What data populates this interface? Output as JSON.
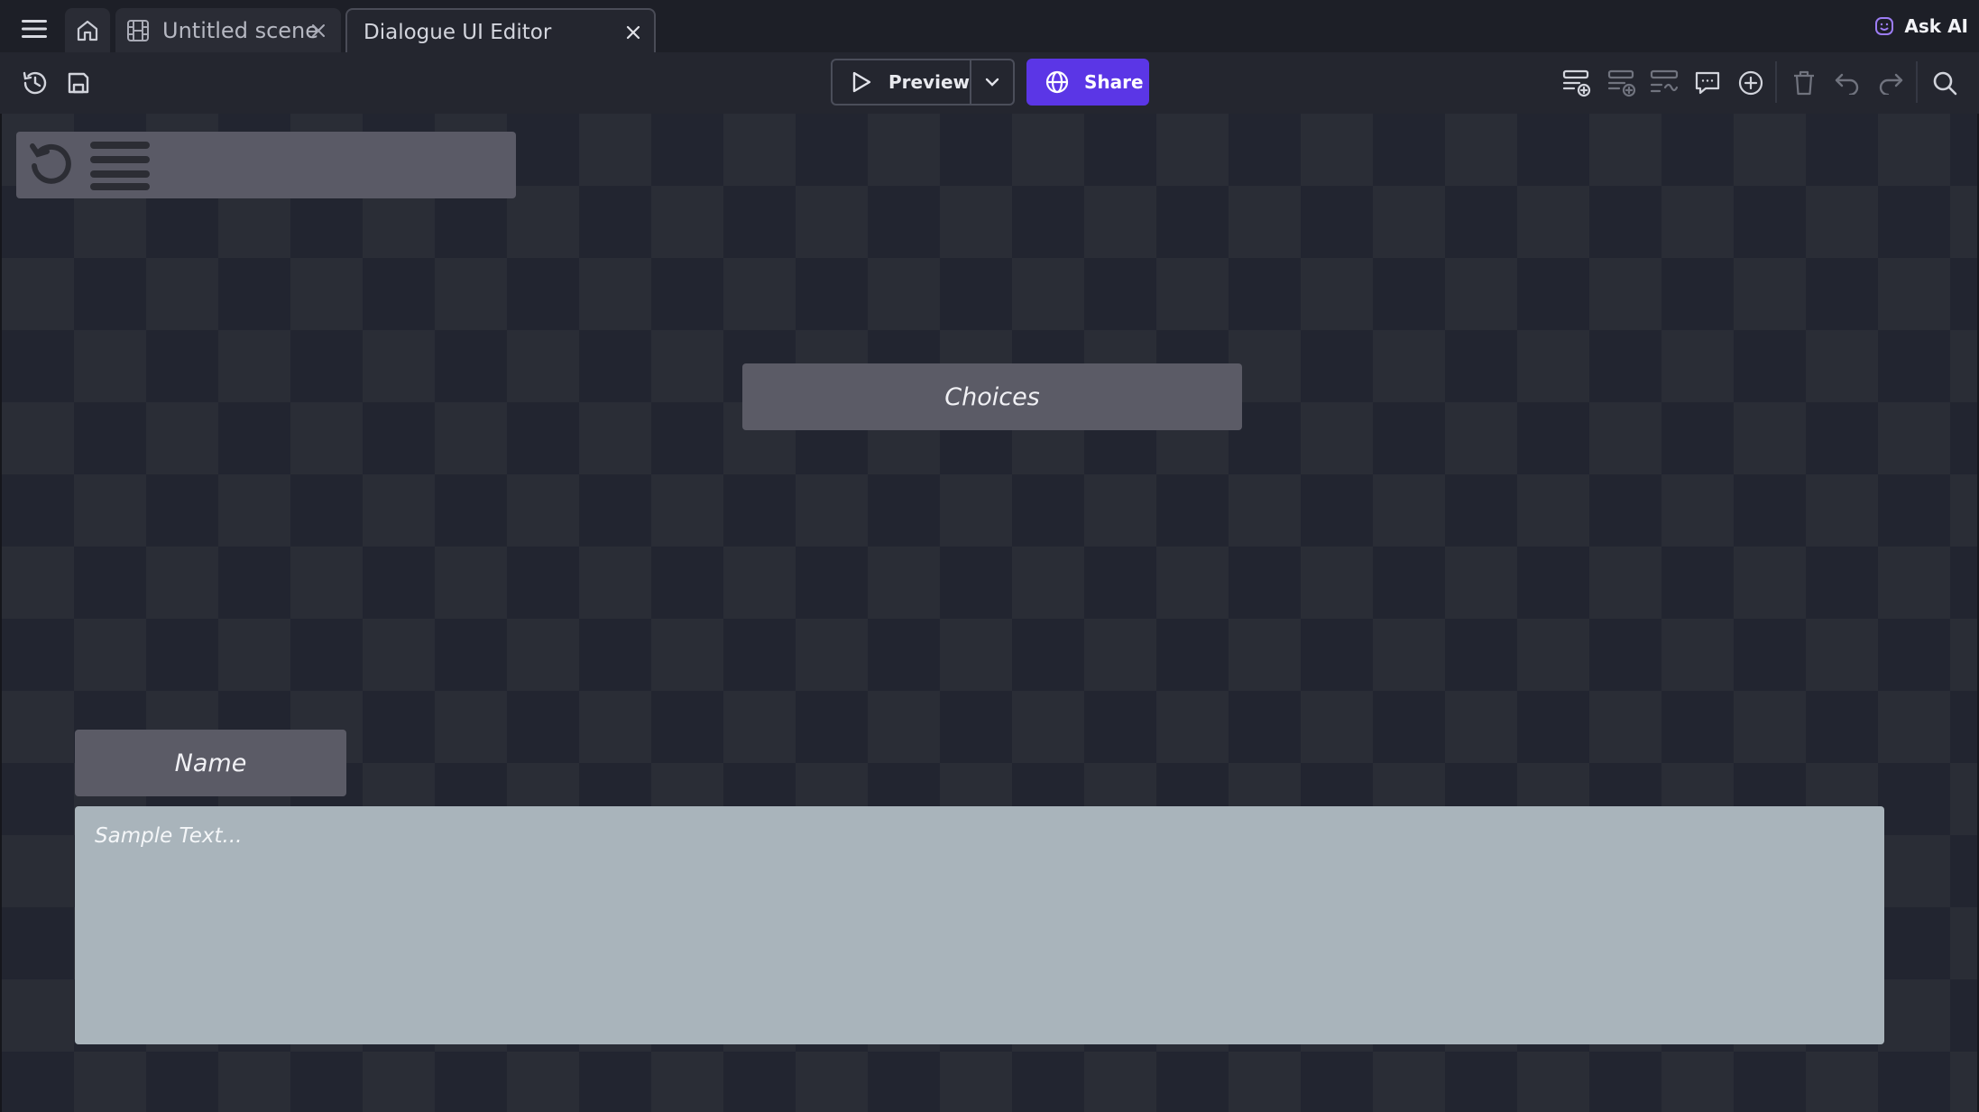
{
  "tabs": {
    "scene_label": "Untitled scene",
    "editor_label": "Dialogue UI Editor"
  },
  "header": {
    "ask_ai_label": "Ask AI"
  },
  "toolbar": {
    "preview_label": "Preview",
    "share_label": "Share",
    "share_color": "#5b36e6"
  },
  "canvas": {
    "choices_label": "Choices",
    "name_label": "Name",
    "text_placeholder": "Sample Text..."
  }
}
